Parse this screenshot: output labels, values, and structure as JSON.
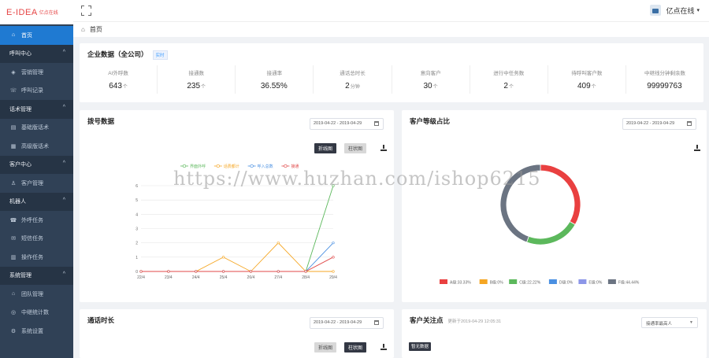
{
  "brand": {
    "logo": "E-IDEA",
    "logo_sub": "亿点在线"
  },
  "sidebar": {
    "home": "首页",
    "groups": [
      {
        "label": "呼叫中心",
        "items": [
          "营销管理",
          "呼叫记录"
        ]
      },
      {
        "label": "话术管理",
        "items": [
          "基础版话术",
          "高级版话术"
        ]
      },
      {
        "label": "客户中心",
        "items": [
          "客户管理"
        ]
      },
      {
        "label": "机器人",
        "items": [
          "外呼任务",
          "短信任务",
          "操作任务"
        ]
      },
      {
        "label": "系统管理",
        "items": [
          "团队管理",
          "中继统计数",
          "系统设置"
        ]
      }
    ]
  },
  "topbar": {
    "user": "亿点在线",
    "caret": "▾"
  },
  "breadcrumb": {
    "home": "首页"
  },
  "company": {
    "title": "企业数据（全公司）",
    "tag": "实时",
    "stats": [
      {
        "label": "AI外呼数",
        "value": "643",
        "unit": "个"
      },
      {
        "label": "接通数",
        "value": "235",
        "unit": "个"
      },
      {
        "label": "接通率",
        "value": "36.55%",
        "unit": ""
      },
      {
        "label": "通话总时长",
        "value": "2",
        "unit": "分钟"
      },
      {
        "label": "意向客户",
        "value": "30",
        "unit": "个"
      },
      {
        "label": "进行中任务数",
        "value": "2",
        "unit": "个"
      },
      {
        "label": "待呼叫客户数",
        "value": "409",
        "unit": "个"
      },
      {
        "label": "中继线分钟剩余数",
        "value": "99999763",
        "unit": ""
      }
    ]
  },
  "dial": {
    "title": "拨号数据",
    "date": "2019-04-22 - 2019-04-29",
    "btn_line": "折线图",
    "btn_bar": "柱状图"
  },
  "level": {
    "title": "客户等级占比",
    "date": "2019-04-22 - 2019-04-29"
  },
  "duration": {
    "title": "通话时长",
    "date": "2019-04-22 - 2019-04-29",
    "btn_line": "折线图",
    "btn_bar": "柱状图"
  },
  "focus": {
    "title": "客户关注点",
    "updated": "更新于2019-04-29 12:05:31",
    "select": "接通率最高人",
    "tag": "暂无数据"
  },
  "watermark": "https://www.huzhan.com/ishop6215",
  "chart_data": [
    {
      "type": "line",
      "title": "拨号数据",
      "categories": [
        "22/4",
        "23/4",
        "24/4",
        "25/4",
        "26/4",
        "27/4",
        "28/4",
        "29/4"
      ],
      "ylim": [
        0,
        6
      ],
      "yticks": [
        "0",
        "1",
        "2",
        "3",
        "4",
        "5",
        "6"
      ],
      "series": [
        {
          "name": "界面外呼",
          "color": "#5cb85c",
          "values": [
            0,
            0,
            0,
            0,
            0,
            0,
            0,
            6
          ]
        },
        {
          "name": "话费都计",
          "color": "#f5a623",
          "values": [
            0,
            0,
            0,
            1,
            0,
            2,
            0,
            0
          ]
        },
        {
          "name": "呼入总数",
          "color": "#4a90e2",
          "values": [
            0,
            0,
            0,
            0,
            0,
            0,
            0,
            2
          ]
        },
        {
          "name": "接通",
          "color": "#e04848",
          "values": [
            0,
            0,
            0,
            0,
            0,
            0,
            0,
            1
          ]
        }
      ]
    },
    {
      "type": "pie",
      "title": "客户等级占比",
      "series": [
        {
          "name": "A级:33.33%",
          "value": 33.33,
          "color": "#e94040"
        },
        {
          "name": "B级:0%",
          "value": 0,
          "color": "#f5a623"
        },
        {
          "name": "C级:22.22%",
          "value": 22.22,
          "color": "#5cb85c"
        },
        {
          "name": "D级:0%",
          "value": 0,
          "color": "#4a90e2"
        },
        {
          "name": "E级:0%",
          "value": 0,
          "color": "#8c96e8"
        },
        {
          "name": "F级:44.44%",
          "value": 44.44,
          "color": "#6b7482"
        }
      ]
    }
  ]
}
